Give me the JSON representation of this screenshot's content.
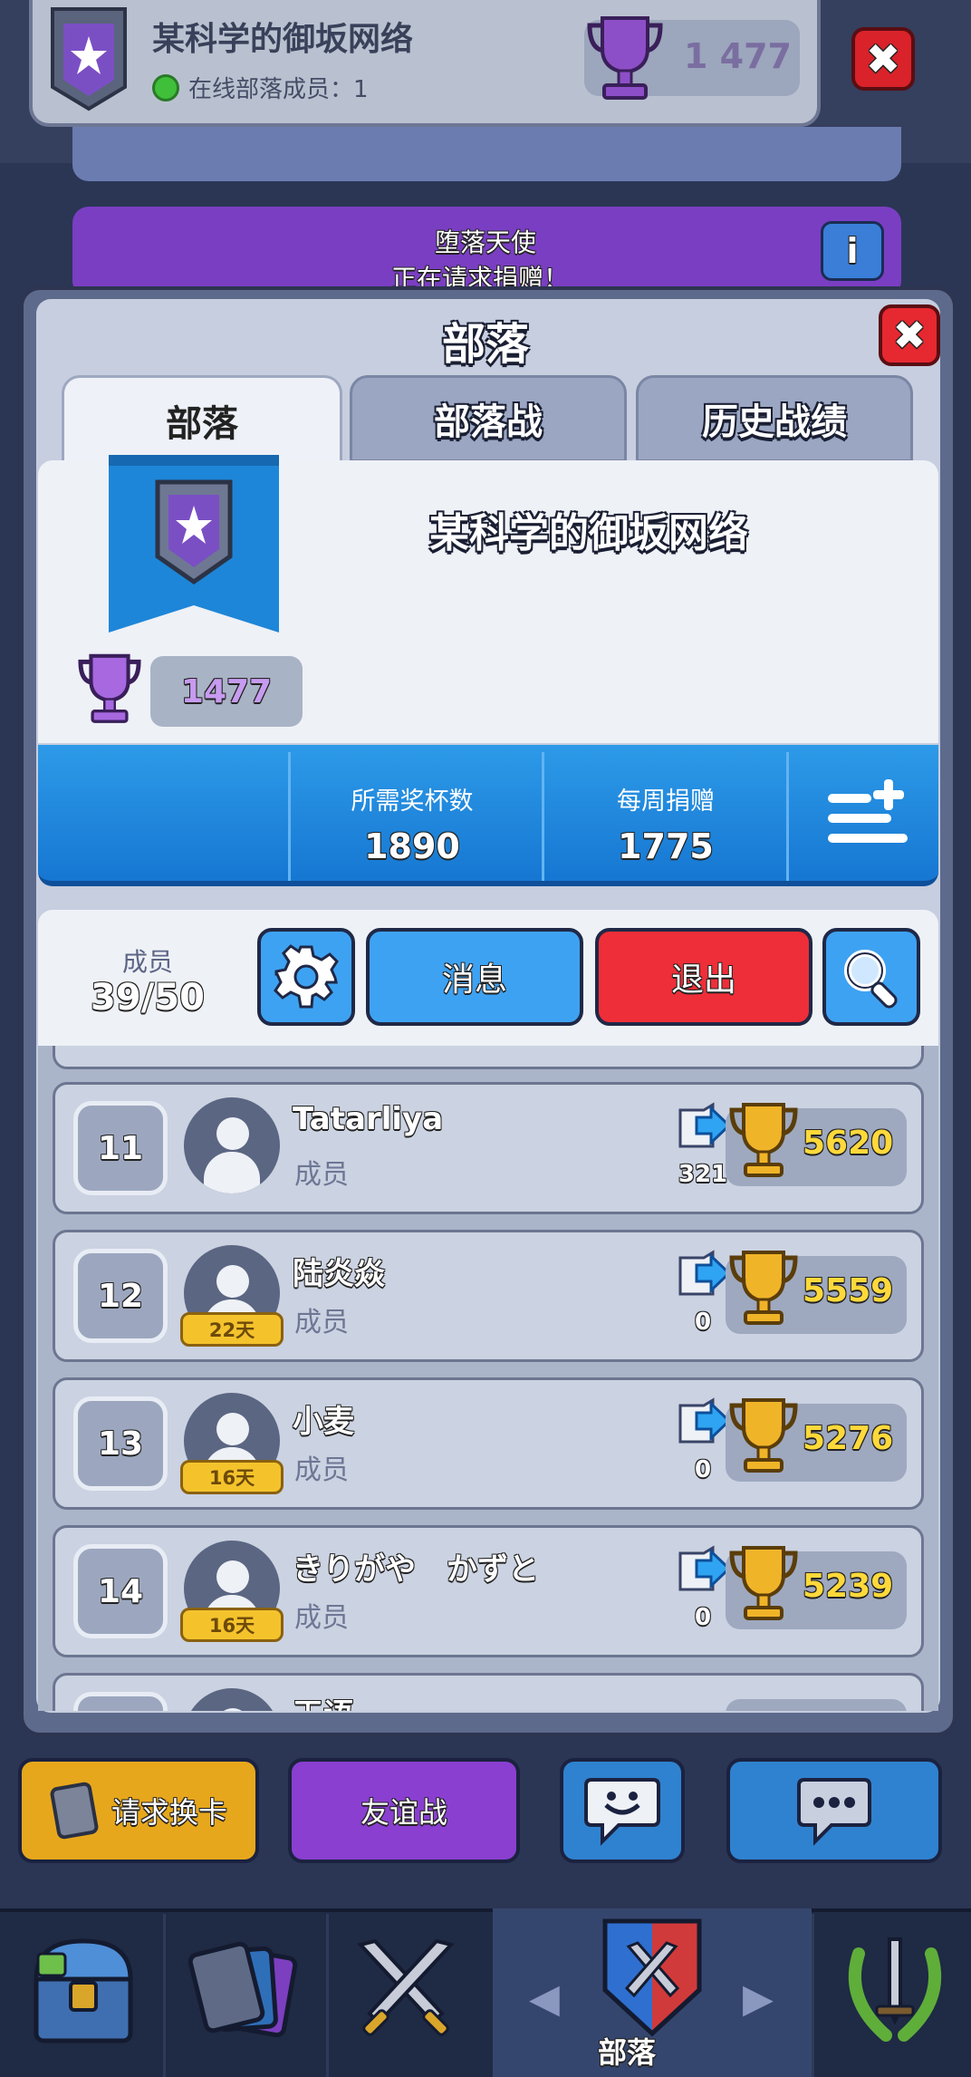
{
  "header": {
    "clan_name": "某科学的御坂网络",
    "online_label": "在线部落成员：1",
    "trophies": "1 477"
  },
  "background": {
    "request_title": "堕落天使",
    "request_sub": "正在请求捐赠！"
  },
  "modal": {
    "title": "部落",
    "tabs": [
      {
        "label": "部落"
      },
      {
        "label": "部落战"
      },
      {
        "label": "历史战绩"
      }
    ]
  },
  "clan": {
    "name": "某科学的御坂网络",
    "trophies": "1477",
    "required_label": "所需奖杯数",
    "required_value": "1890",
    "weekly_label": "每周捐赠",
    "weekly_value": "1775"
  },
  "members_header": {
    "label": "成员",
    "count": "39/50",
    "message_button": "消息",
    "leave_button": "退出"
  },
  "members": [
    {
      "rank": "11",
      "name": "Tatarliya",
      "role": "成员",
      "donations": "321",
      "trophies": "5620",
      "days": ""
    },
    {
      "rank": "12",
      "name": "陆炎焱",
      "role": "成员",
      "donations": "0",
      "trophies": "5559",
      "days": "22天"
    },
    {
      "rank": "13",
      "name": "小麦",
      "role": "成员",
      "donations": "0",
      "trophies": "5276",
      "days": "16天"
    },
    {
      "rank": "14",
      "name": "きりがや　かずと",
      "role": "成员",
      "donations": "0",
      "trophies": "5239",
      "days": "16天"
    },
    {
      "rank": "",
      "name": "王语",
      "role": "",
      "donations": "",
      "trophies": "",
      "days": ""
    }
  ],
  "actions": {
    "request_cards": "请求换卡",
    "friendly_battle": "友谊战"
  },
  "nav": {
    "clan_label": "部落"
  },
  "colors": {
    "accent_blue": "#3ea2f2",
    "leave_red": "#ee2e38",
    "trophy_gold": "#ffd93a",
    "friendly_purple": "#8a3fd0",
    "request_yellow": "#e7a71c"
  }
}
